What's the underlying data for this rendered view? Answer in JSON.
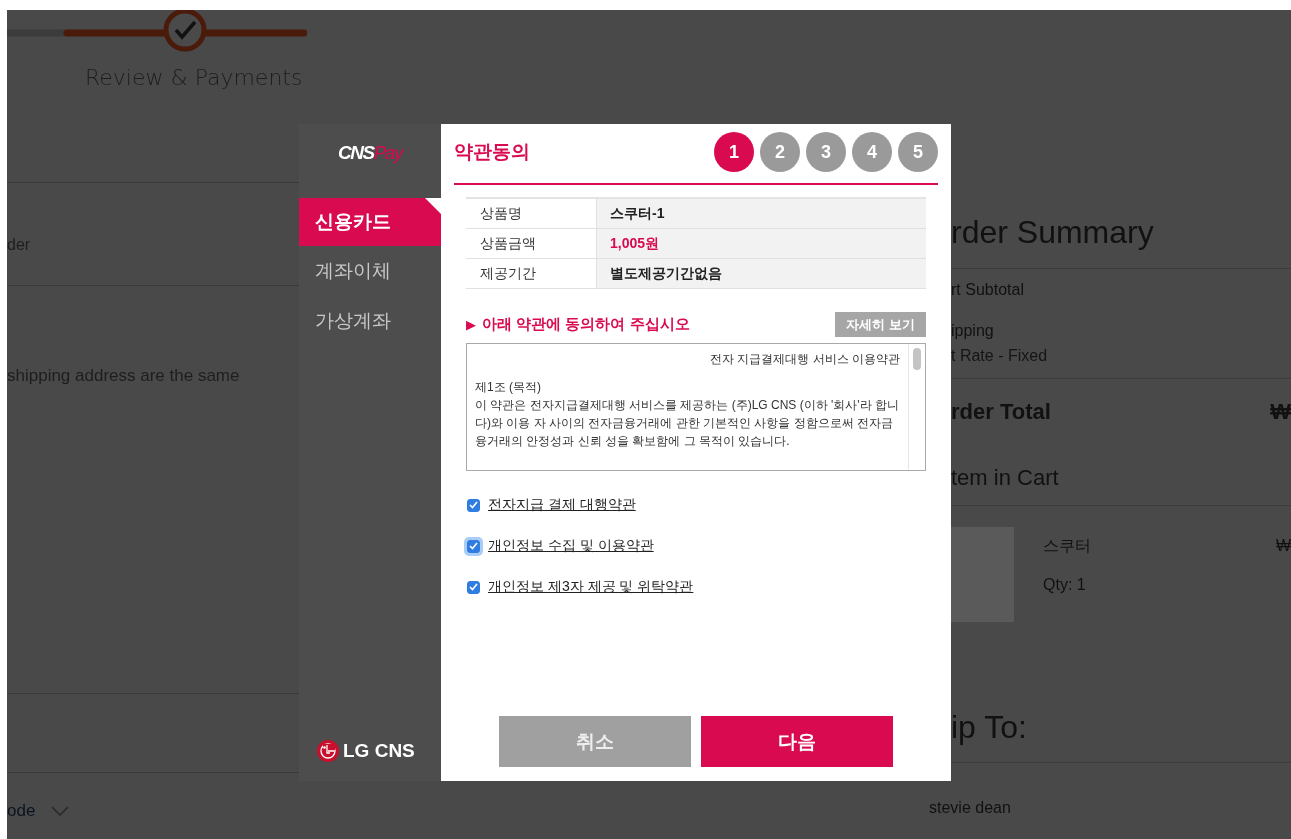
{
  "background_page": {
    "progress_step": {
      "label": "Review & Payments",
      "completed": true
    },
    "left_column": {
      "row_text": "der",
      "same_address_text": "shipping address are the same",
      "discount_toggle": "ode"
    },
    "order_summary": {
      "title": "rder Summary",
      "subtotal_label": "rt Subtotal",
      "shipping_label": "ipping",
      "shipping_method": "t Rate - Fixed",
      "total_label": "rder Total",
      "total_value": "₩",
      "items_heading": "tem in Cart",
      "item": {
        "name": "스쿠터",
        "qty": "Qty: 1",
        "price": "₩"
      }
    },
    "ship_to": {
      "title": "ip To:",
      "name": "stevie dean"
    }
  },
  "payment_dialog": {
    "logo": {
      "main": "CNS",
      "accent": "Pay"
    },
    "methods": [
      {
        "label": "신용카드",
        "selected": true
      },
      {
        "label": "계좌이체",
        "selected": false
      },
      {
        "label": "가상계좌",
        "selected": false
      }
    ],
    "footer_logo": "LG CNS",
    "title": "약관동의",
    "steps": [
      {
        "label": "1",
        "selected": true
      },
      {
        "label": "2",
        "selected": false
      },
      {
        "label": "3",
        "selected": false
      },
      {
        "label": "4",
        "selected": false
      },
      {
        "label": "5",
        "selected": false
      }
    ],
    "product_info": [
      {
        "label": "상품명",
        "value": "스쿠터-1",
        "kind": "text"
      },
      {
        "label": "상품금액",
        "value": "1,005원",
        "kind": "price"
      },
      {
        "label": "제공기간",
        "value": "별도제공기간없음",
        "kind": "text"
      }
    ],
    "agree_marker": "▶",
    "agree_prompt": "아래 약관에 동의하여 주십시오",
    "details_button": "자세히 보기",
    "terms": {
      "heading": "전자 지급결제대행 서비스 이용약관",
      "article_title": "제1조 (목적)",
      "article_body": "이 약관은 전자지급결제대행 서비스를 제공하는 (주)LG CNS (이하 '회사'라 합니다)와 이용 자 사이의 전자금융거래에 관한 기본적인 사항을 정함으로써 전자금융거래의 안정성과 신뢰 성을 확보함에 그 목적이 있습니다."
    },
    "agreements": [
      {
        "label": "전자지급 결제 대행약관",
        "checked": true,
        "focused": false
      },
      {
        "label": "개인정보 수집 및 이용약관",
        "checked": true,
        "focused": true
      },
      {
        "label": "개인정보 제3자 제공 및 위탁약관",
        "checked": true,
        "focused": false
      }
    ],
    "buttons": [
      {
        "label": "취소",
        "kind": "cancel"
      },
      {
        "label": "다음",
        "kind": "primary"
      }
    ]
  }
}
